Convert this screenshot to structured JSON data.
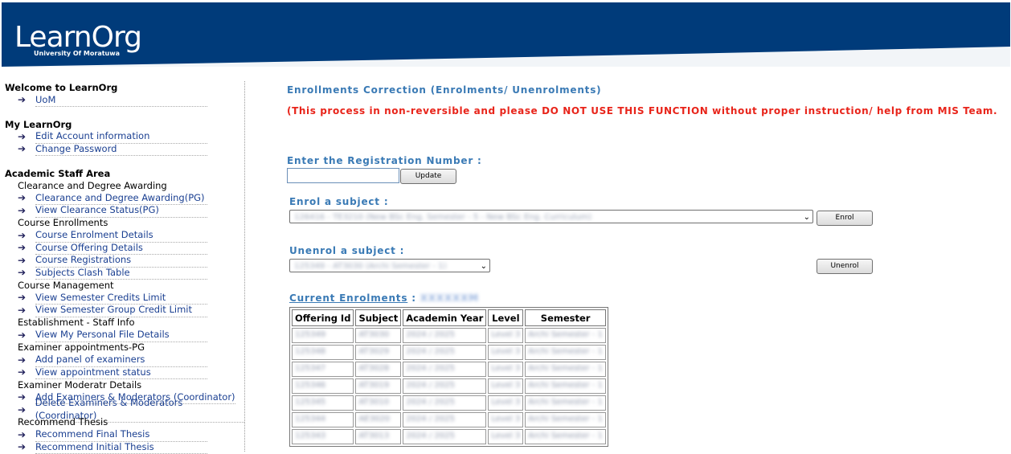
{
  "header": {
    "logo_name": "LearnOrg",
    "logo_sub": "University Of Moratuwa",
    "bg_color": "#003b7a"
  },
  "sidebar": {
    "sections": [
      {
        "title": "Welcome to LearnOrg",
        "items": [
          {
            "type": "link",
            "label": "UoM"
          }
        ]
      },
      {
        "title": "My LearnOrg",
        "items": [
          {
            "type": "link",
            "label": "Edit Account information"
          },
          {
            "type": "link",
            "label": "Change Password"
          }
        ]
      },
      {
        "title": "Academic Staff Area",
        "items": [
          {
            "type": "head",
            "label": "Clearance and Degree Awarding"
          },
          {
            "type": "link",
            "label": "Clearance and Degree Awarding(PG)"
          },
          {
            "type": "link",
            "label": "View Clearance Status(PG)"
          },
          {
            "type": "head",
            "label": "Course Enrollments"
          },
          {
            "type": "link",
            "label": "Course Enrolment Details"
          },
          {
            "type": "link",
            "label": "Course Offering Details"
          },
          {
            "type": "link",
            "label": "Course Registrations"
          },
          {
            "type": "link",
            "label": "Subjects Clash Table"
          },
          {
            "type": "head",
            "label": "Course Management"
          },
          {
            "type": "link",
            "label": "View Semester Credits Limit"
          },
          {
            "type": "link",
            "label": "View Semester Group Credit Limit"
          },
          {
            "type": "head",
            "label": "Establishment - Staff Info"
          },
          {
            "type": "link",
            "label": "View My Personal File Details"
          },
          {
            "type": "head",
            "label": "Examiner appointments-PG"
          },
          {
            "type": "link",
            "label": "Add panel of examiners"
          },
          {
            "type": "link",
            "label": "View appointment status"
          },
          {
            "type": "head",
            "label": "Examiner Moderatr Details"
          },
          {
            "type": "link",
            "label": "Add Examiners & Moderators (Coordinator)"
          },
          {
            "type": "link",
            "label": "Delete Examiners & Moderators (Coordinator)"
          },
          {
            "type": "head",
            "label": "Recommend Thesis"
          },
          {
            "type": "link",
            "label": "Recommend Final Thesis"
          },
          {
            "type": "link",
            "label": "Recommend Initial Thesis"
          }
        ]
      }
    ]
  },
  "main": {
    "title": "Enrollments Correction (Enrolments/ Unenrolments)",
    "warning": "(This process in non-reversible and please DO NOT USE THIS FUNCTION without proper instruction/ help from MIS Team.",
    "reg_label": "Enter the Registration Number :",
    "reg_value": "",
    "update_btn": "Update",
    "enrol_label": "Enrol a subject :",
    "enrol_selected": "126416 - TE3210 (New BSc Eng. Semester - 5 - New BSc Eng. Curriculum)",
    "enrol_btn": "Enrol",
    "unenrol_label": "Unenrol a subject :",
    "unenrol_selected": "125349 - AT3030 (Archi Semester - 1)",
    "unenrol_btn": "Unenrol",
    "current_label": "Current Enrolments",
    "current_sep": " : ",
    "current_id": "XXXXXXM",
    "table": {
      "headers": [
        "Offering Id",
        "Subject",
        "Academin Year",
        "Level",
        "Semester"
      ],
      "rows": [
        [
          "125349",
          "AT3030",
          "2024 / 2025",
          "Level 3",
          "Archi Semester - 1"
        ],
        [
          "125348",
          "AT3029",
          "2024 / 2025",
          "Level 3",
          "Archi Semester - 1"
        ],
        [
          "125347",
          "AT3028",
          "2024 / 2025",
          "Level 3",
          "Archi Semester - 1"
        ],
        [
          "125346",
          "AT3019",
          "2024 / 2025",
          "Level 3",
          "Archi Semester - 1"
        ],
        [
          "125345",
          "AT3010",
          "2024 / 2025",
          "Level 3",
          "Archi Semester - 1"
        ],
        [
          "125344",
          "AE3020",
          "2024 / 2025",
          "Level 3",
          "Archi Semester - 1"
        ],
        [
          "125343",
          "AT3013",
          "2024 / 2025",
          "Level 3",
          "Archi Semester - 1"
        ]
      ]
    }
  }
}
